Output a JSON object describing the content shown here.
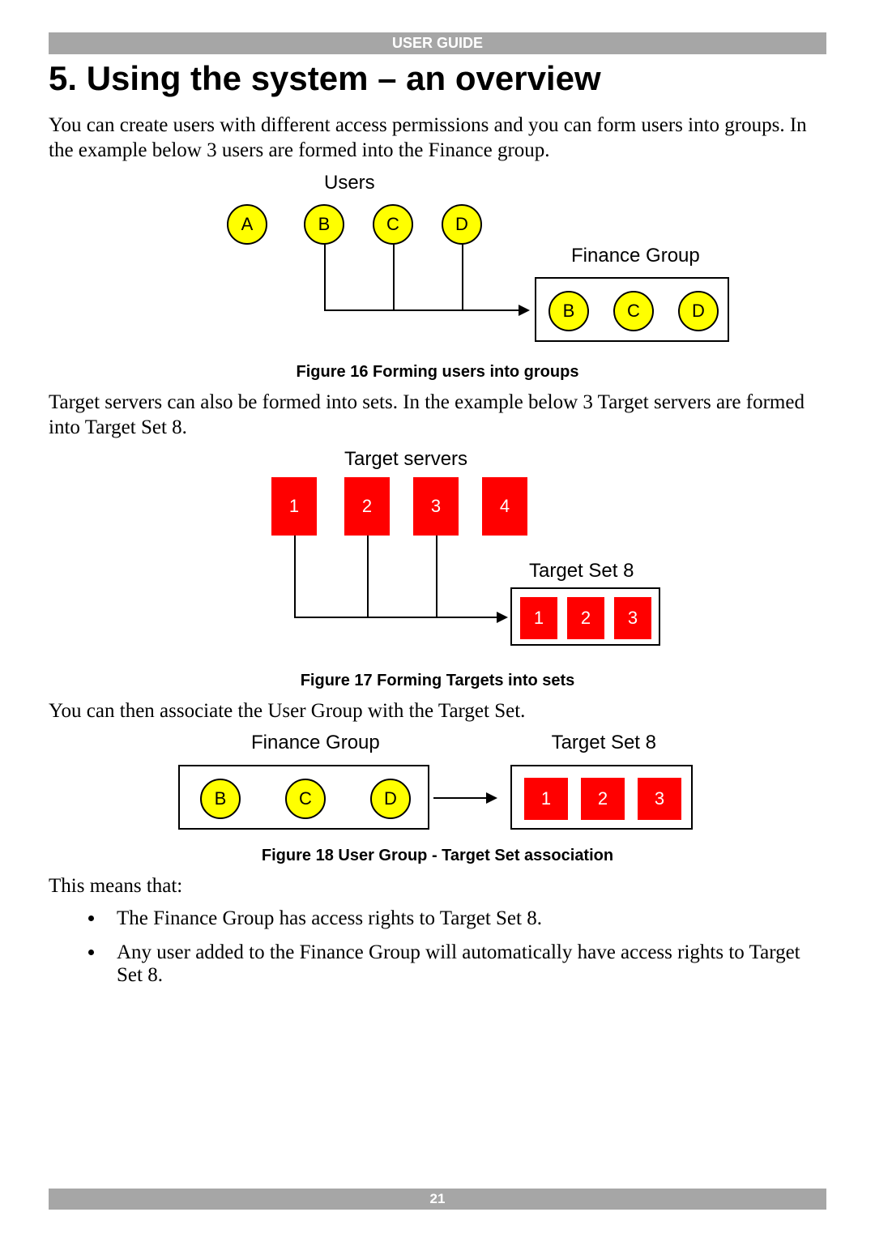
{
  "header": "USER GUIDE",
  "title": "5. Using the system – an overview",
  "p1": "You can create users with different access permissions and you can form users into groups. In the example below 3 users are formed into the Finance group.",
  "fig16": {
    "users_label": "Users",
    "users": [
      "A",
      "B",
      "C",
      "D"
    ],
    "group_label": "Finance Group",
    "group_members": [
      "B",
      "C",
      "D"
    ],
    "caption": "Figure 16 Forming users into groups"
  },
  "p2": "Target servers can also be formed into sets. In the example below 3 Target servers are formed into Target Set 8.",
  "fig17": {
    "servers_label": "Target servers",
    "servers": [
      "1",
      "2",
      "3",
      "4"
    ],
    "set_label": "Target Set 8",
    "set_members": [
      "1",
      "2",
      "3"
    ],
    "caption": "Figure 17 Forming Targets into sets"
  },
  "p3": "You can then associate the User Group with the Target Set.",
  "fig18": {
    "group_label": "Finance Group",
    "group_members": [
      "B",
      "C",
      "D"
    ],
    "set_label": "Target Set 8",
    "set_members": [
      "1",
      "2",
      "3"
    ],
    "caption": "Figure 18 User Group - Target Set association"
  },
  "p4": "This means that:",
  "bullets": [
    "The Finance Group has access rights to Target Set 8.",
    "Any user added to the Finance Group will automatically have access rights to Target Set 8."
  ],
  "page_number": "21"
}
